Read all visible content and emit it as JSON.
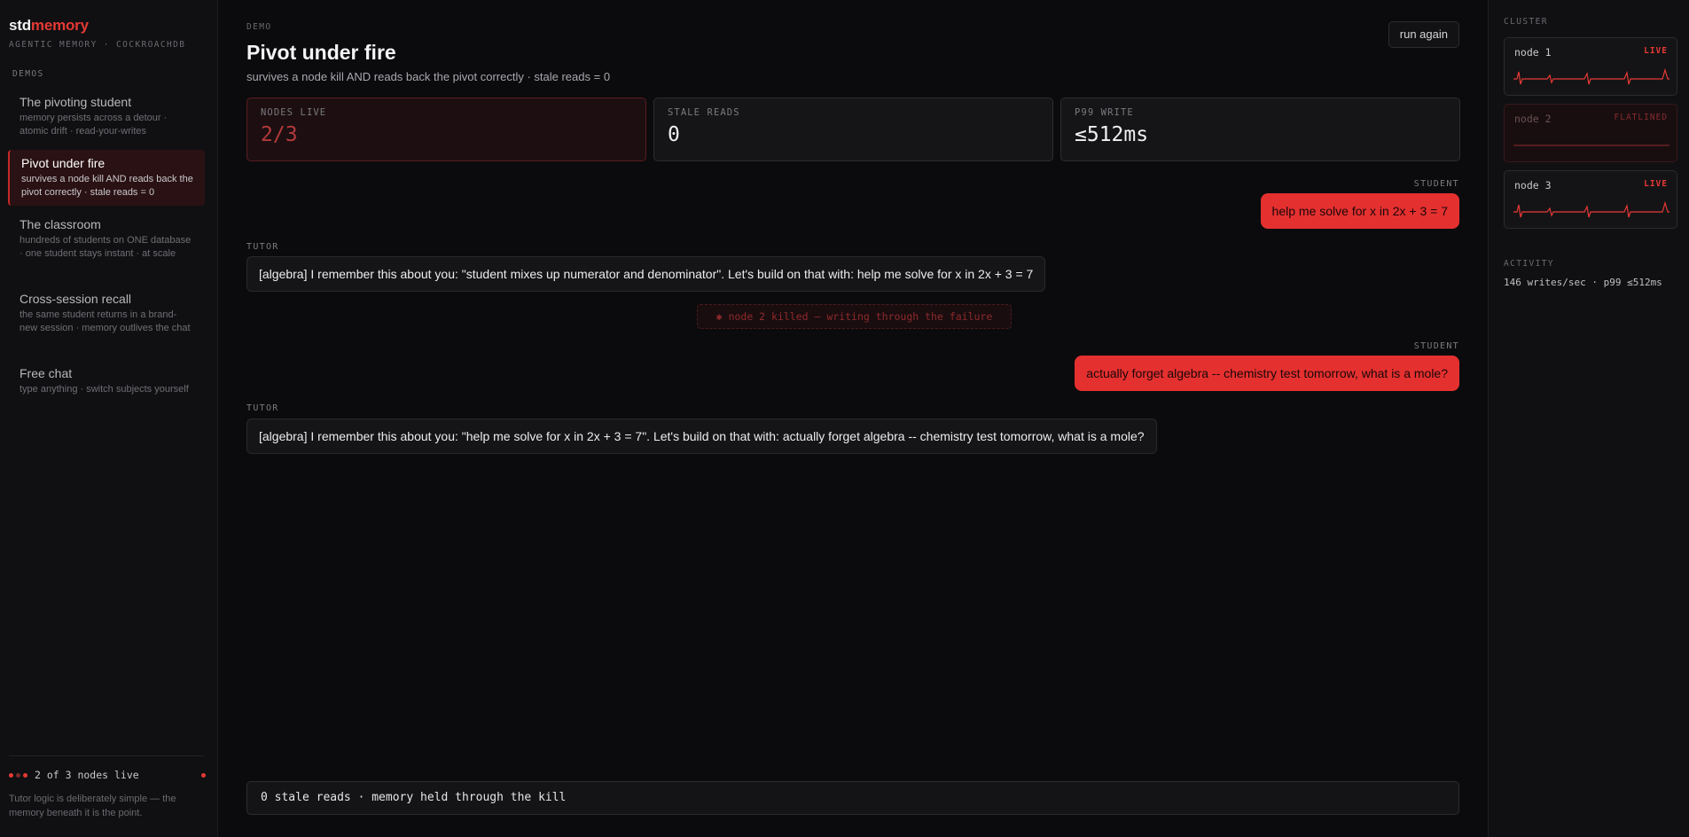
{
  "brand": {
    "part1": "std",
    "part2": "memory",
    "tagline": "AGENTIC MEMORY · COCKROACHDB"
  },
  "sidebar": {
    "section_label": "DEMOS",
    "items": [
      {
        "title": "The pivoting student",
        "desc": "memory persists across a detour · atomic drift · read-your-writes",
        "active": false
      },
      {
        "title": "Pivot under fire",
        "desc": "survives a node kill AND reads back the pivot correctly · stale reads = 0",
        "active": true
      },
      {
        "title": "The classroom",
        "desc": "hundreds of students on ONE database · one student stays instant · at scale",
        "active": false
      },
      {
        "title": "Cross-session recall",
        "desc": "the same student returns in a brand-new session · memory outlives the chat",
        "active": false
      },
      {
        "title": "Free chat",
        "desc": "type anything · switch subjects yourself",
        "active": false
      }
    ],
    "node_status": "2 of 3 nodes live",
    "note": "Tutor logic is deliberately simple — the memory beneath it is the point."
  },
  "main": {
    "eyebrow": "DEMO",
    "title": "Pivot under fire",
    "subtitle": "survives a node kill AND reads back the pivot correctly · stale reads = 0",
    "run_again": "run again",
    "stats": [
      {
        "label": "NODES LIVE",
        "value": "2/3"
      },
      {
        "label": "STALE READS",
        "value": "0"
      },
      {
        "label": "P99 WRITE",
        "value": "≤512ms"
      }
    ],
    "messages": [
      {
        "role": "STUDENT",
        "text": "help me solve for x in 2x + 3 = 7"
      },
      {
        "role": "TUTOR",
        "text": "[algebra] I remember this about you: \"student mixes up numerator and denominator\". Let's build on that with: help me solve for x in 2x + 3 = 7"
      },
      {
        "role": "STUDENT",
        "text": "actually forget algebra -- chemistry test tomorrow, what is a mole?"
      },
      {
        "role": "TUTOR",
        "text": "[algebra] I remember this about you: \"help me solve for x in 2x + 3 = 7\". Let's build on that with: actually forget algebra -- chemistry test tomorrow, what is a mole?"
      }
    ],
    "event": "✱ node 2 killed — writing through the failure",
    "footer": "0 stale reads · memory held through the kill"
  },
  "cluster": {
    "label": "CLUSTER",
    "nodes": [
      {
        "name": "node 1",
        "status": "LIVE"
      },
      {
        "name": "node 2",
        "status": "FLATLINED"
      },
      {
        "name": "node 3",
        "status": "LIVE"
      }
    ],
    "activity_label": "ACTIVITY",
    "activity": "146 writes/sec · p99 ≤512ms"
  },
  "colors": {
    "accent": "#e53935",
    "user_bubble": "#e53030",
    "background": "#0b0b0d"
  }
}
